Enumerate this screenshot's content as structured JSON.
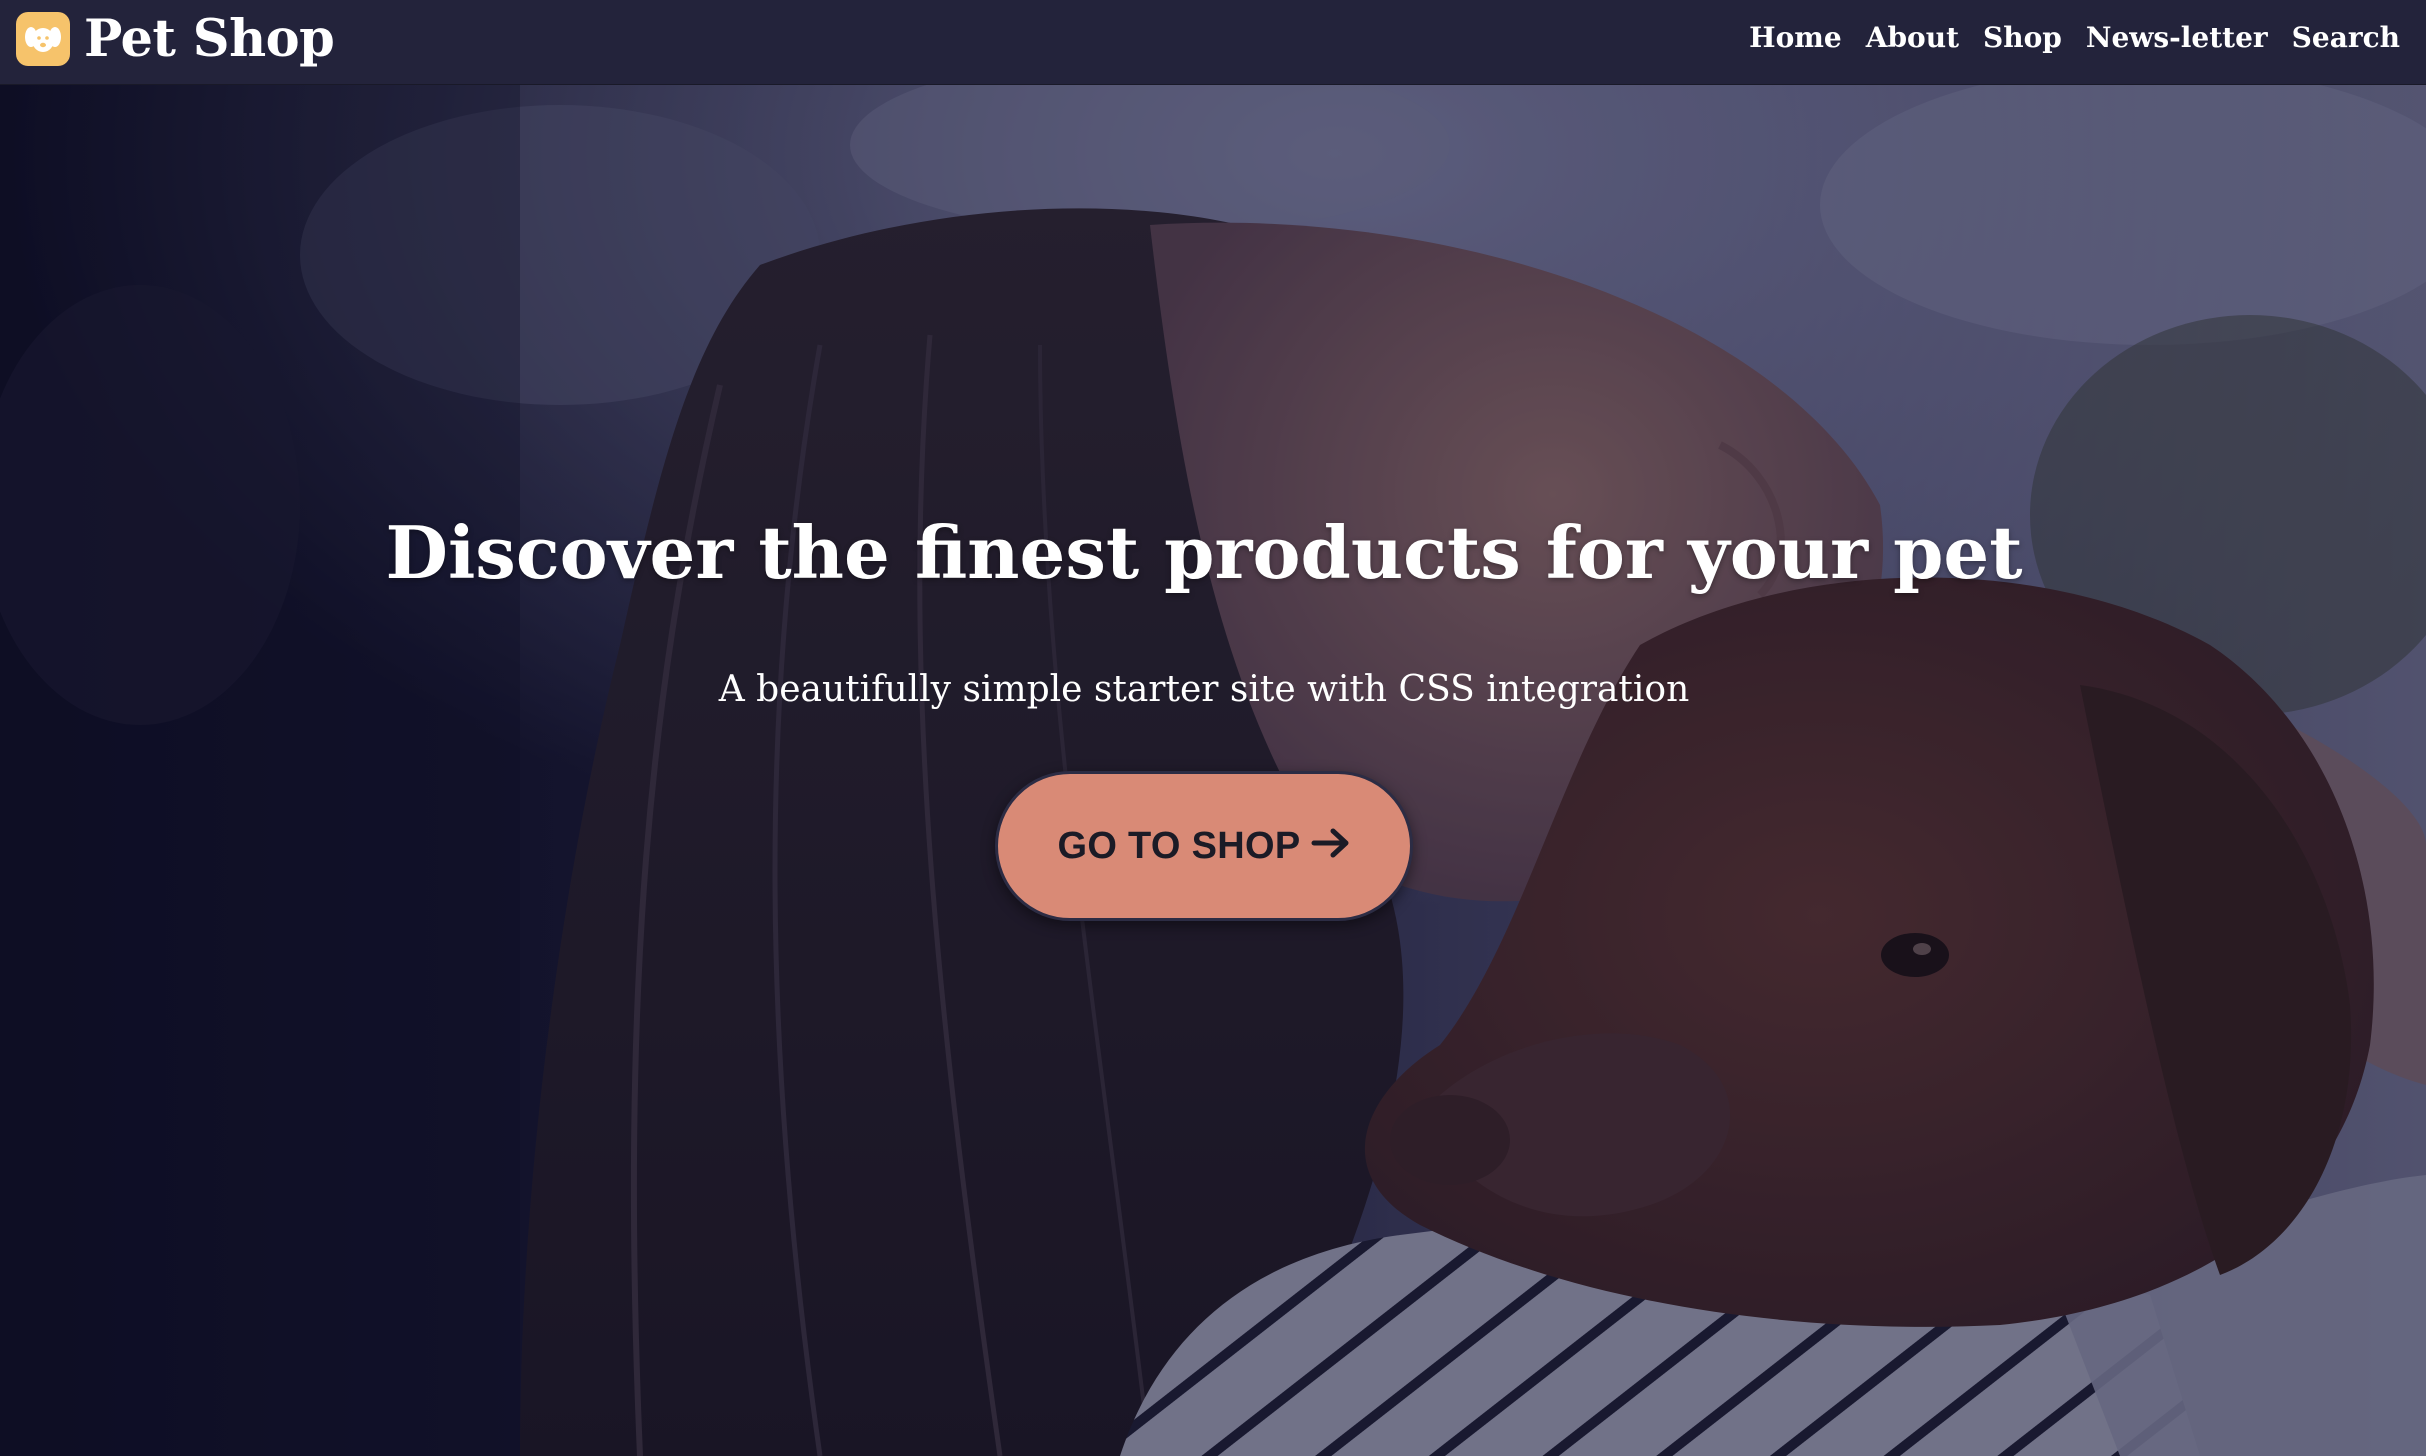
{
  "header": {
    "brand_name": "Pet Shop",
    "logo_icon": "dog-face-icon",
    "nav": [
      {
        "label": "Home"
      },
      {
        "label": "About"
      },
      {
        "label": "Shop"
      },
      {
        "label": "News-letter"
      },
      {
        "label": "Search"
      }
    ]
  },
  "hero": {
    "heading": "Discover the finest products for your pet",
    "subheading": "A beautifully simple starter site with CSS integration",
    "cta_label": "GO TO SHOP",
    "cta_icon": "arrow-right-icon",
    "cta_color": "#d98a76",
    "image": "woman-hugging-brown-dog-photo"
  },
  "colors": {
    "header_bg": "#23233b",
    "accent": "#f6c36b"
  }
}
